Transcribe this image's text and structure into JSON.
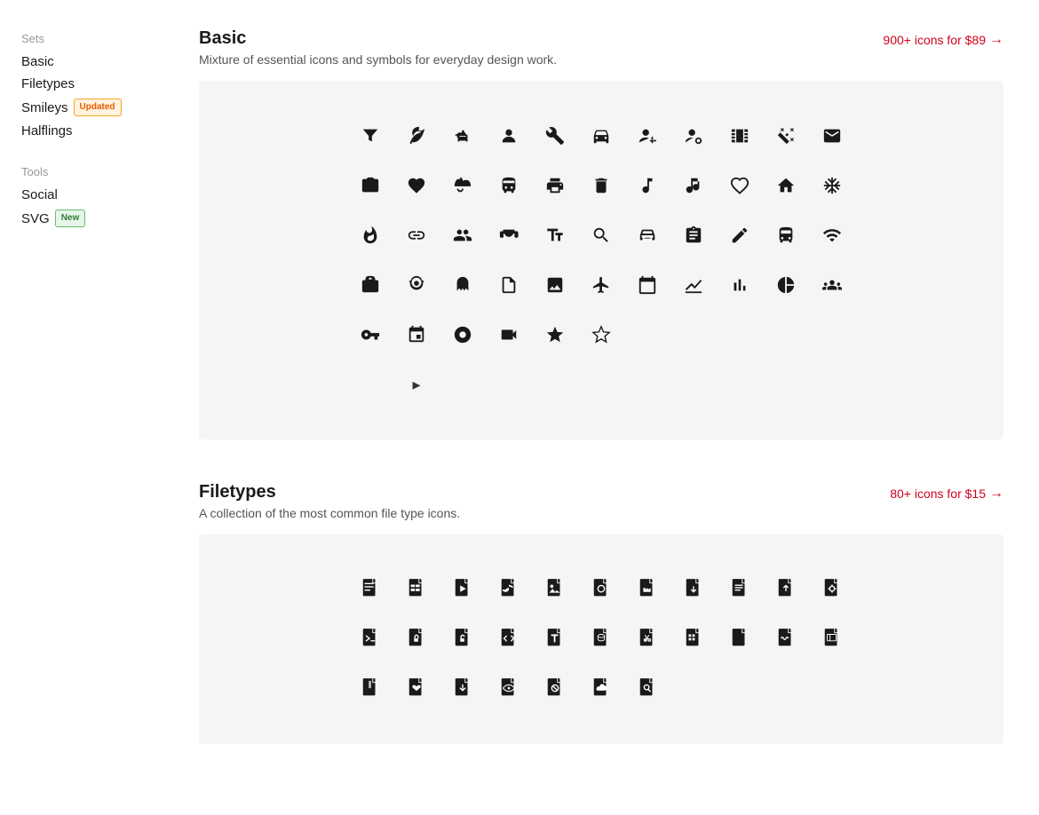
{
  "sidebar": {
    "sets_label": "Sets",
    "tools_label": "Tools",
    "sets_items": [
      {
        "id": "basic",
        "label": "Basic",
        "badge": null
      },
      {
        "id": "filetypes",
        "label": "Filetypes",
        "badge": null
      },
      {
        "id": "smileys",
        "label": "Smileys",
        "badge": "Updated",
        "badge_type": "updated"
      },
      {
        "id": "halflings",
        "label": "Halflings",
        "badge": null
      }
    ],
    "tools_items": [
      {
        "id": "social",
        "label": "Social",
        "badge": null
      },
      {
        "id": "svg",
        "label": "SVG",
        "badge": "New",
        "badge_type": "new"
      }
    ]
  },
  "sets": [
    {
      "id": "basic",
      "title": "Basic",
      "description": "Mixture of essential icons and symbols for everyday design work.",
      "cta_label": "900+ icons for $89",
      "icons_row1": [
        "▼",
        "🍃",
        "🐕",
        "👤",
        "⚙",
        "🚗",
        "👤+",
        "👤⚙",
        "🎞",
        "✨"
      ],
      "icons_row2": [
        "✉",
        "📷",
        "♥",
        "☂",
        "🚌",
        "🖨",
        "🗑",
        "♪",
        "🎵",
        "♡"
      ],
      "icons_row3": [
        "🏠",
        "❄",
        "🔥",
        "🔗",
        "👥",
        "🎩",
        "🔤",
        "🔍",
        "🚘",
        "📋"
      ],
      "icons_row4": [
        "✏",
        "🚌",
        "📡",
        "🧳",
        "🕵",
        "👻",
        "📄",
        "🖼",
        "✈",
        "📅"
      ],
      "icons_row5": [
        "📈",
        "📊",
        "📉",
        "👥",
        "🔑",
        "📅",
        "📡",
        "📹",
        "★",
        "☆"
      ]
    },
    {
      "id": "filetypes",
      "title": "Filetypes",
      "description": "A collection of the most common file type icons.",
      "cta_label": "80+ icons for $15",
      "icons_row1": [
        "📄",
        "📋",
        "📄🎵",
        "📄♪",
        "📄▶",
        "📄🖼",
        "📄📷",
        "📄💾",
        "📄☰",
        "📄⬇"
      ],
      "icons_row2": [
        "📄⚙",
        "📄>_",
        "📄🔒",
        "📄🔓",
        "📄</>",
        "📄T",
        "📄📊",
        "📄✂",
        "📄⊞"
      ],
      "icons_row3": [
        "📄",
        "📄~",
        "📄📦",
        "📄🗜",
        "📄♥",
        "📄⬇",
        "📄👁",
        "📄⊘",
        "📄☁",
        "📄🔍"
      ]
    }
  ],
  "icons": {
    "basic_grid": [
      "⛛",
      "🍃",
      "🐕",
      "👤",
      "⚙",
      "🚗",
      "👤",
      "👤",
      "🎞",
      "✦",
      "✉",
      "📷",
      "♥",
      "☂",
      "🚌",
      "🖨",
      "🗑",
      "♩",
      "𝄞",
      "♡",
      "🏠",
      "❄",
      "🔥",
      "⊕",
      "👥",
      "🎩",
      "𝔸",
      "🔍",
      "🚗",
      "📋",
      "✏",
      "🚌",
      "◉",
      "💼",
      "🕵",
      "👻",
      "📄",
      "🖼",
      "✈",
      "📅",
      "↗",
      "▐▌",
      "◑",
      "👥",
      "🗝",
      "📅",
      "◉",
      "🎥",
      "★",
      "✩"
    ],
    "filetypes_grid": [
      "📄",
      "📋",
      "📄",
      "📄",
      "📄",
      "📄",
      "📄",
      "📄",
      "📄",
      "📄",
      "📄",
      "📄",
      "📄",
      "📄",
      "📄",
      "📄",
      "📄",
      "📄",
      "📄",
      "📄",
      "📄",
      "📄",
      "📄",
      "📄",
      "📄",
      "📄",
      "📄",
      "📄",
      "📄"
    ]
  }
}
